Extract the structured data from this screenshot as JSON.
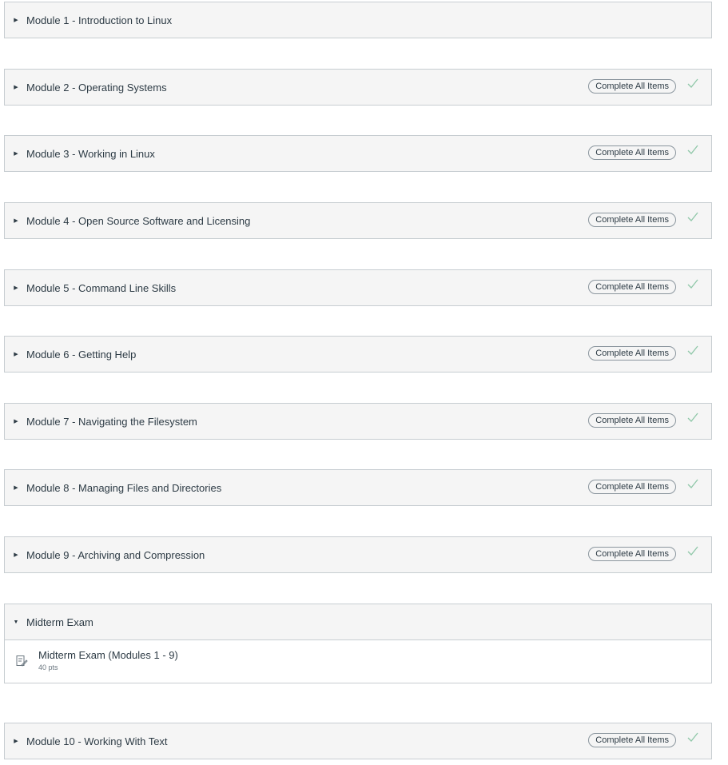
{
  "modules": [
    {
      "title": "Module 1 - Introduction to Linux",
      "expanded": false,
      "complete_label": null,
      "completed": false
    },
    {
      "title": "Module 2 - Operating Systems",
      "expanded": false,
      "complete_label": "Complete All Items",
      "completed": true
    },
    {
      "title": "Module 3 - Working in Linux",
      "expanded": false,
      "complete_label": "Complete All Items",
      "completed": true
    },
    {
      "title": "Module 4 - Open Source Software and Licensing",
      "expanded": false,
      "complete_label": "Complete All Items",
      "completed": true
    },
    {
      "title": "Module 5 - Command Line Skills",
      "expanded": false,
      "complete_label": "Complete All Items",
      "completed": true
    },
    {
      "title": "Module 6 - Getting Help",
      "expanded": false,
      "complete_label": "Complete All Items",
      "completed": true
    },
    {
      "title": "Module 7 - Navigating the Filesystem",
      "expanded": false,
      "complete_label": "Complete All Items",
      "completed": true
    },
    {
      "title": "Module 8 - Managing Files and Directories",
      "expanded": false,
      "complete_label": "Complete All Items",
      "completed": true
    },
    {
      "title": "Module 9 - Archiving and Compression",
      "expanded": false,
      "complete_label": "Complete All Items",
      "completed": true
    },
    {
      "title": "Midterm Exam",
      "expanded": true,
      "complete_label": null,
      "completed": false,
      "items": [
        {
          "title": "Midterm Exam (Modules 1 - 9)",
          "points": "40 pts",
          "icon": "quiz-icon"
        }
      ]
    },
    {
      "title": "Module 10 - Working With Text",
      "expanded": false,
      "complete_label": "Complete All Items",
      "completed": true
    }
  ],
  "colors": {
    "header_bg": "#f5f5f5",
    "border": "#c7cdd1",
    "check": "#8fc7a8",
    "text": "#2d3b45"
  }
}
